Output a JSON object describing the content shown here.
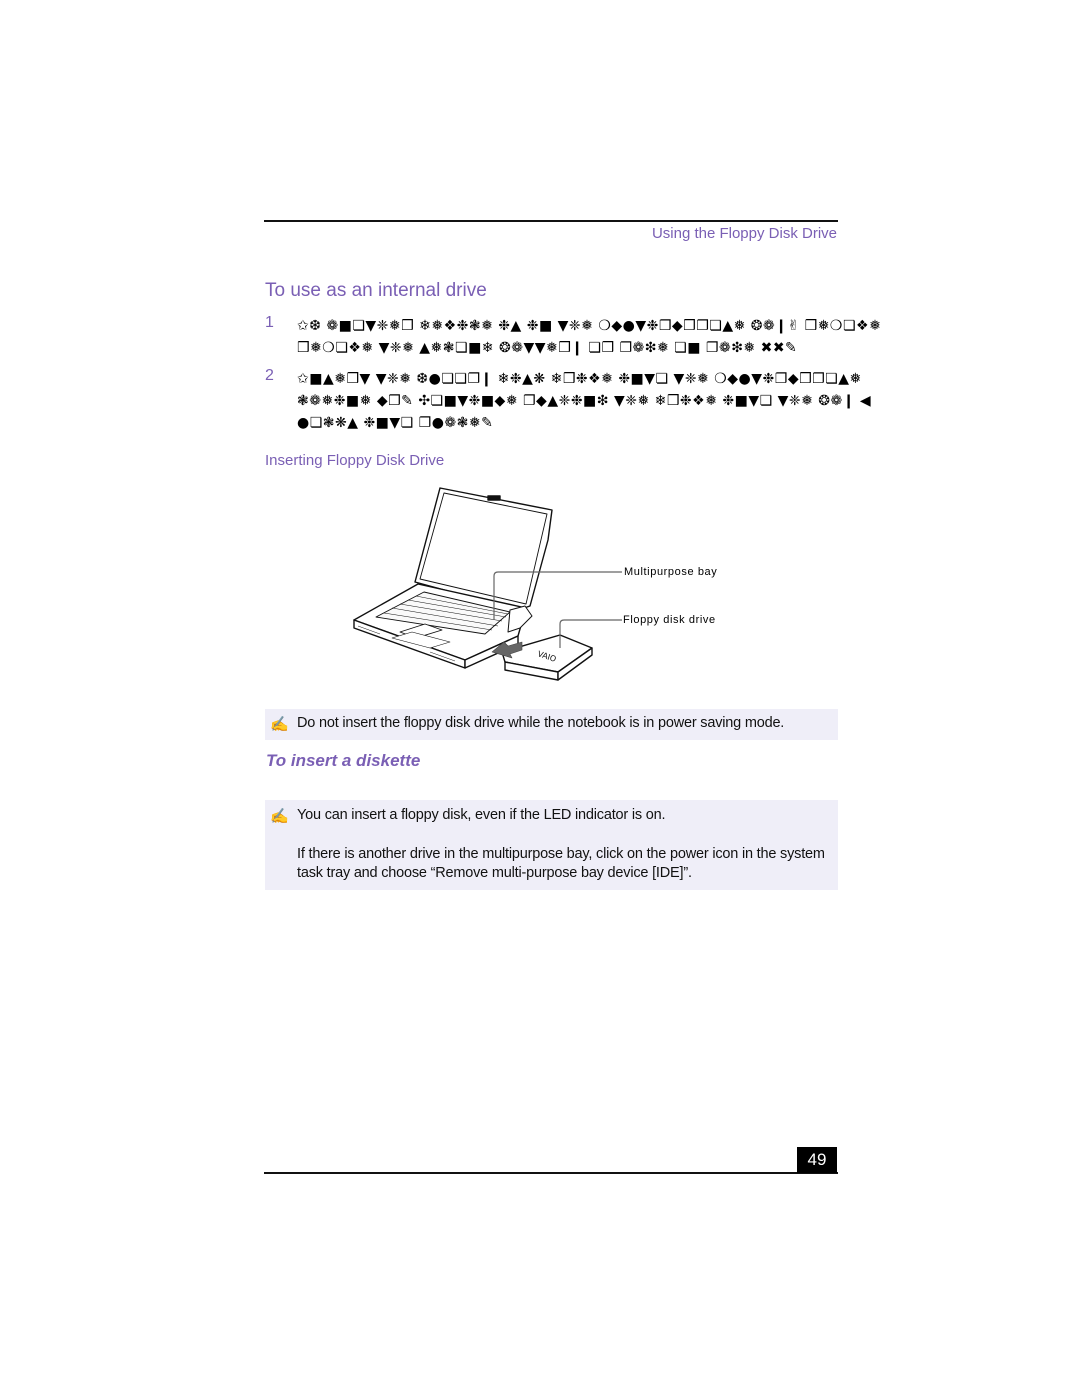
{
  "header": {
    "title": "Using the Floppy Disk Drive"
  },
  "section": {
    "title": "To use as an internal drive"
  },
  "steps": [
    {
      "number": "1",
      "lines": [
        "✩❆ ❁■❏▼❈❅❒ ❄❅❖❉❃❅ ❉▲ ❉■ ▼❈❅ ❍◆●▼❉❐◆❒❐❏▲❅ ❂❁❙✌ ❒❅❍❏❖❅",
        "❒❅❍❏❖❅ ▼❈❅ ▲❅❃❏■❄ ❂❁▼▼❅❒❙ ❏❒ ❐❁❇❅ ❏■ ❐❁❇❅ ✖✖✎"
      ]
    },
    {
      "number": "2",
      "lines": [
        "✩■▲❅❒▼ ▼❈❅ ❆●❏❏❐❙ ❄❉▲❋ ❄❒❉❖❅ ❉■▼❏ ▼❈❅ ❍◆●▼❉❐◆❒❐❏▲❅",
        "❃❁❅❉■❅ ◆❐✎ ✣❏■▼❉■◆❅ ❐◆▲❈❉■❇ ▼❈❅ ❄❒❉❖❅ ❉■▼❏ ▼❈❅ ❂❁❙ ◀",
        "●❏❃❋▲ ❉■▼❏ ❐●❁❃❅✎"
      ]
    }
  ],
  "figure": {
    "caption": "Inserting Floppy Disk Drive",
    "callouts": [
      "Multipurpose bay",
      "Floppy disk drive"
    ],
    "brand_mark": "VAIO"
  },
  "notes": [
    {
      "icon": "note-pencil-icon",
      "paragraphs": [
        "Do not insert the floppy disk drive while the notebook is in power saving mode."
      ]
    },
    {
      "icon": "note-pencil-icon",
      "paragraphs": [
        "You can insert a floppy disk, even if the LED indicator is on.",
        "If there is another drive in the multipurpose bay, click on the power icon in the system",
        "task tray and choose “Remove multi-purpose bay device [IDE]”."
      ]
    }
  ],
  "subsection": {
    "title": "To insert a diskette"
  },
  "footer": {
    "page_number": "49"
  },
  "colors": {
    "accent": "#7a5fb4",
    "note_background": "#efeef8",
    "rule": "#111111"
  }
}
